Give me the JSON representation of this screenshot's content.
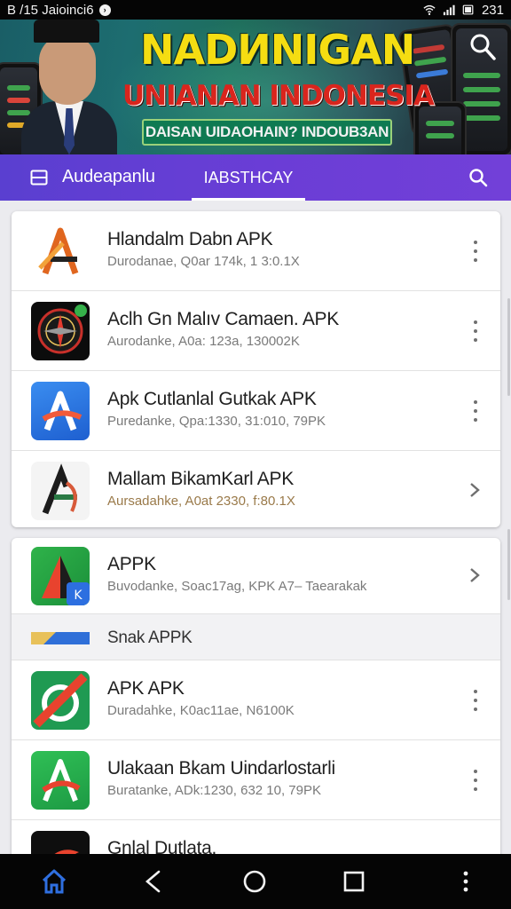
{
  "status_bar": {
    "left_text": "B /15 Jaioinci6",
    "notification_icon": "notification-circle-icon",
    "time": "231",
    "icons": [
      "wifi-icon",
      "signal-icon",
      "battery-icon"
    ]
  },
  "banner": {
    "title": "NADИNIGAN",
    "subtitle": "UNIANAN INDONESIA",
    "strip": "DAISAN UIDAOHAIN? INDOUB3AN",
    "colors": {
      "title": "#f5dd12",
      "subtitle": "#d9251d",
      "strip": "#0f7a52"
    }
  },
  "app_bar": {
    "app_name": "Audeapanlu",
    "active_tab": "IABSTHCAY",
    "accent": "#6b3dd6"
  },
  "list_card_1": [
    {
      "title": "Hlandalm Dabn APK",
      "meta": "Durodanae,  Q0ar 174k,  1 3:0.1X",
      "action": "more",
      "icon": "a-logo-orange-icon"
    },
    {
      "title": "Aclh Gn Malıv Camaen. APK",
      "meta": "Aurodanke,  A0a: 123a,  130002K",
      "action": "more",
      "icon": "compass-dial-icon"
    },
    {
      "title": "Apk Cutlanlal Gutkak APK",
      "meta": "Puredanke,  Qpa:1330,  31:010,  79PK",
      "action": "more",
      "icon": "a-logo-blue-icon"
    },
    {
      "title": "Mallam BikamKarl APK",
      "meta": "Aursadahke,  A0at 2330,  f:80.1X",
      "action": "chevron",
      "icon": "a-logo-dark-icon"
    }
  ],
  "list_card_2": [
    {
      "title": "APPK",
      "meta": "Buvodanke,  Soac17ag,  KPK  A7– Taearakak",
      "action": "chevron",
      "icon": "a-logo-green-icon"
    },
    {
      "section_label": "Snak APPK",
      "icon": "blue-strip-icon"
    },
    {
      "title": "APK APK",
      "meta": "Duradahke,  K0ac11ae,  N6100K",
      "action": "more",
      "icon": "slash-logo-green-icon"
    },
    {
      "title": "Ulakaan Bkam Uindarlostarli",
      "meta": "Buratanke,  ADk:1230,  632 10,  79PK",
      "action": "more",
      "icon": "a-logo-green-2-icon"
    },
    {
      "title": "Gnlal Dutlata.",
      "meta": "",
      "action": "none",
      "icon": "bird-logo-icon"
    }
  ],
  "nav_bar": {
    "items": [
      "home-icon",
      "back-icon",
      "circle-home-icon",
      "recents-icon",
      "more-vertical-icon"
    ],
    "active_color": "#2f6fe0"
  }
}
